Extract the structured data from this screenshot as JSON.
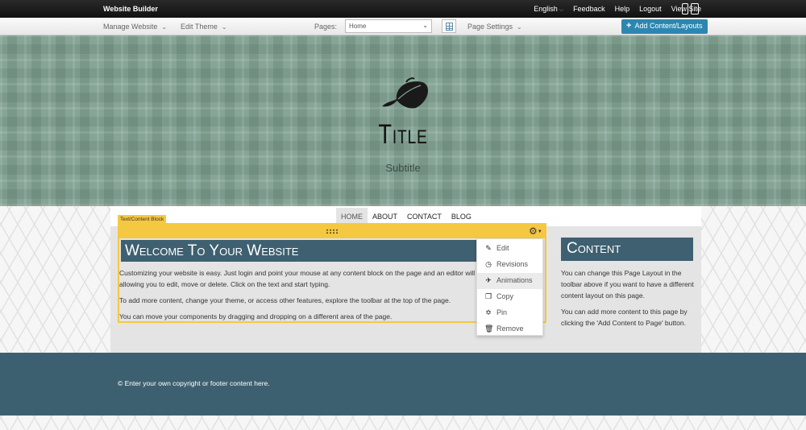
{
  "topbar": {
    "brand": "Website Builder",
    "language": "English",
    "feedback": "Feedback",
    "help": "Help",
    "logout": "Logout",
    "view_site": "View Site"
  },
  "toolbar": {
    "manage_website": "Manage Website",
    "edit_theme": "Edit Theme",
    "pages_label": "Pages:",
    "page_selected": "Home",
    "page_settings": "Page Settings",
    "add_content": "Add Content/Layouts"
  },
  "header": {
    "title": "Title",
    "subtitle": "Subtitle"
  },
  "menu": {
    "items": [
      {
        "label": "HOME"
      },
      {
        "label": "ABOUT"
      },
      {
        "label": "CONTACT"
      },
      {
        "label": "BLOG"
      }
    ]
  },
  "content_block": {
    "tag": "Text/Content Block",
    "heading": "Welcome To Your Website",
    "paragraphs": [
      "Customizing your website is easy. Just login and point your mouse at any content block on the page and an editor will appear allowing you to edit, move or delete.  Click on the text and start typing.",
      "To add more content, change your theme, or access other features, explore the toolbar at the top of the page.",
      "You can move your components by dragging and dropping on a different area of the page."
    ]
  },
  "dropdown": {
    "items": [
      {
        "label": "Edit",
        "icon": "edit-icon"
      },
      {
        "label": "Revisions",
        "icon": "clock-icon"
      },
      {
        "label": "Animations",
        "icon": "plane-icon"
      },
      {
        "label": "Copy",
        "icon": "copy-icon"
      },
      {
        "label": "Pin",
        "icon": "pin-icon"
      },
      {
        "label": "Remove",
        "icon": "trash-icon"
      }
    ],
    "highlighted": "Animations"
  },
  "sidebar": {
    "heading": "Content",
    "paragraphs": [
      "You can change this Page Layout in the toolbar above if you want to have a different content layout on this page.",
      "You can add more content to this page by clicking the 'Add Content to Page' button."
    ]
  },
  "footer": {
    "text": "© Enter your own copyright or footer content here."
  },
  "colors": {
    "accent_blue": "#2c87b0",
    "header_green": "#86a596",
    "heading_teal": "#3e6070",
    "block_yellow": "#f5c842"
  }
}
